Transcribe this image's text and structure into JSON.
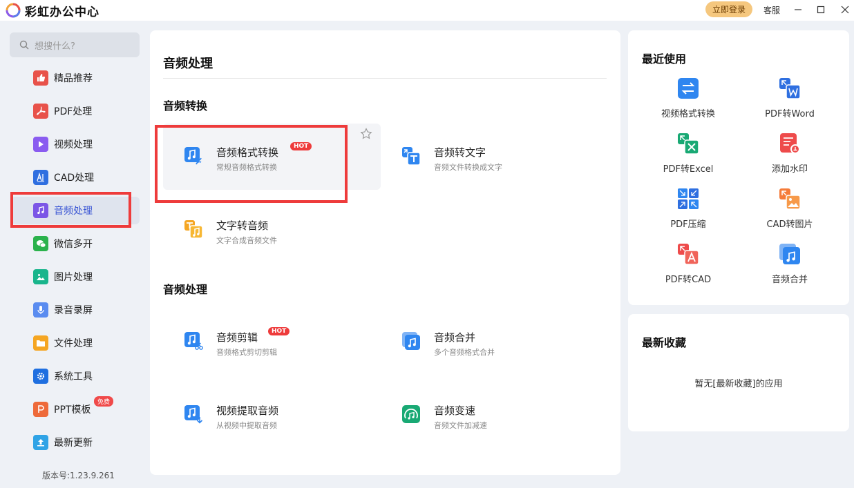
{
  "app": {
    "title": "彩虹办公中心"
  },
  "titlebar": {
    "login_label": "立即登录",
    "service_label": "客服"
  },
  "sidebar": {
    "search_placeholder": "想搜什么?",
    "items": [
      {
        "label": "精品推荐",
        "icon": "thumbs-up-icon",
        "color": "#e8524a"
      },
      {
        "label": "PDF处理",
        "icon": "pdf-icon",
        "color": "#e8524a"
      },
      {
        "label": "视频处理",
        "icon": "video-play-icon",
        "color": "#8a5cf0"
      },
      {
        "label": "CAD处理",
        "icon": "cad-icon",
        "color": "#2f6fe0"
      },
      {
        "label": "音频处理",
        "icon": "music-note-icon",
        "color": "#7b55e6"
      },
      {
        "label": "微信多开",
        "icon": "wechat-icon",
        "color": "#2bb24c"
      },
      {
        "label": "图片处理",
        "icon": "image-icon",
        "color": "#19b58c"
      },
      {
        "label": "录音录屏",
        "icon": "microphone-icon",
        "color": "#5a8cf0"
      },
      {
        "label": "文件处理",
        "icon": "folder-icon",
        "color": "#f5a623"
      },
      {
        "label": "系统工具",
        "icon": "gear-icon",
        "color": "#1f6fe0"
      },
      {
        "label": "PPT模板",
        "icon": "ppt-icon",
        "color": "#ee6a3a",
        "badge": "免费"
      },
      {
        "label": "最新更新",
        "icon": "upload-icon",
        "color": "#2fa3e6"
      }
    ],
    "version": "版本号:1.23.9.261"
  },
  "main": {
    "title": "音频处理",
    "sections": [
      {
        "title": "音频转换",
        "tools": [
          {
            "name": "音频格式转换",
            "desc": "常规音频格式转换",
            "hot": "HOT"
          },
          {
            "name": "音频转文字",
            "desc": "音频文件转换成文字"
          },
          {
            "name": "文字转音频",
            "desc": "文字合成音频文件"
          }
        ]
      },
      {
        "title": "音频处理",
        "tools": [
          {
            "name": "音频剪辑",
            "desc": "音频格式剪切剪辑",
            "hot": "HOT"
          },
          {
            "name": "音频合并",
            "desc": "多个音频格式合并"
          },
          {
            "name": "视频提取音频",
            "desc": "从视频中提取音频"
          },
          {
            "name": "音频变速",
            "desc": "音频文件加减速"
          }
        ]
      }
    ]
  },
  "recent": {
    "title": "最近使用",
    "items": [
      {
        "label": "视频格式转换",
        "icon": "swap-arrows-icon"
      },
      {
        "label": "PDF转Word",
        "icon": "pdf-to-word-icon"
      },
      {
        "label": "PDF转Excel",
        "icon": "pdf-to-excel-icon"
      },
      {
        "label": "添加水印",
        "icon": "watermark-icon"
      },
      {
        "label": "PDF压缩",
        "icon": "pdf-compress-icon"
      },
      {
        "label": "CAD转图片",
        "icon": "cad-to-image-icon"
      },
      {
        "label": "PDF转CAD",
        "icon": "pdf-to-cad-icon"
      },
      {
        "label": "音频合并",
        "icon": "audio-merge-icon"
      }
    ]
  },
  "favorites": {
    "title": "最新收藏",
    "empty_text": "暂无[最新收藏]的应用"
  }
}
